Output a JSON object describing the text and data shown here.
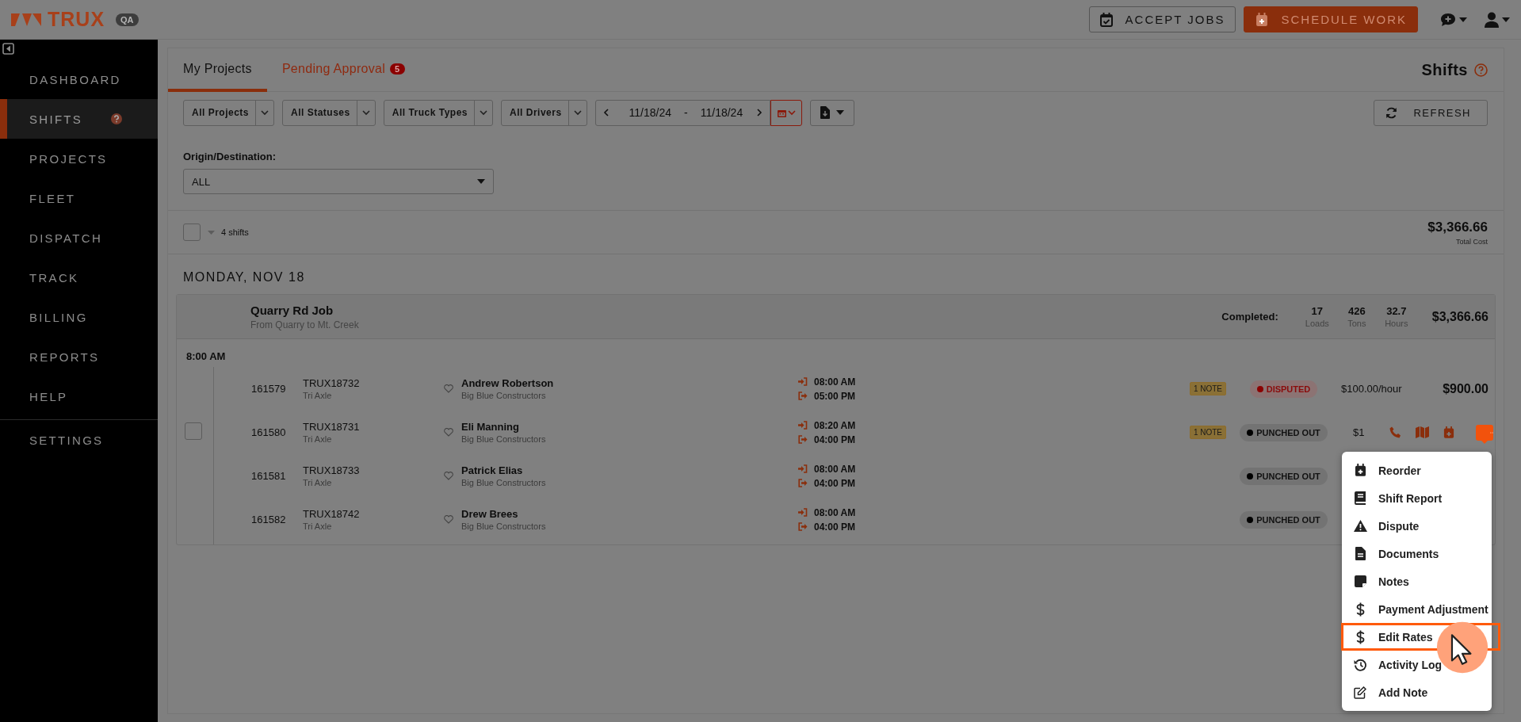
{
  "header": {
    "logo": "TRUX",
    "env_badge": "QA",
    "buttons": [
      {
        "label": "ACCEPT JOBS",
        "kind": "outline"
      },
      {
        "label": "SCHEDULE WORK",
        "kind": "primary"
      }
    ]
  },
  "sidebar": {
    "items": [
      {
        "label": "DASHBOARD",
        "selected": false,
        "help": false
      },
      {
        "label": "SHIFTS",
        "selected": true,
        "help": true
      },
      {
        "label": "PROJECTS",
        "selected": false,
        "help": false
      },
      {
        "label": "FLEET",
        "selected": false,
        "help": false
      },
      {
        "label": "DISPATCH",
        "selected": false,
        "help": false
      },
      {
        "label": "TRACK",
        "selected": false,
        "help": false
      },
      {
        "label": "BILLING",
        "selected": false,
        "help": false
      },
      {
        "label": "REPORTS",
        "selected": false,
        "help": false
      },
      {
        "label": "HELP",
        "selected": false,
        "help": false
      }
    ],
    "footer_items": [
      {
        "label": "SETTINGS",
        "selected": false,
        "help": false
      }
    ]
  },
  "tabs": [
    {
      "label": "My Projects",
      "selected": true
    },
    {
      "label": "Pending Approval",
      "selected": false,
      "badge": "5"
    }
  ],
  "page_title": "Shifts",
  "filters": [
    {
      "label": "All Projects"
    },
    {
      "label": "All Statuses"
    },
    {
      "label": "All Truck Types"
    },
    {
      "label": "All Drivers"
    }
  ],
  "date_range": {
    "start": "11/18/24",
    "separator": "-",
    "end": "11/18/24"
  },
  "refresh": "REFRESH",
  "origin": {
    "label": "Origin/Destination:",
    "value": "ALL"
  },
  "summary": {
    "checked": false,
    "count": "4 shifts",
    "total": "$3,366.66",
    "total_label": "Total Cost"
  },
  "day": "MONDAY, NOV 18",
  "job": {
    "name": "Quarry Rd Job",
    "route": "From Quarry to Mt. Creek",
    "completed_label": "Completed:",
    "stats": [
      {
        "value": "17",
        "label": "Loads"
      },
      {
        "value": "426",
        "label": "Tons"
      },
      {
        "value": "32.7",
        "label": "Hours"
      }
    ],
    "total": "$3,366.66"
  },
  "time_label": "8:00 AM",
  "shifts": [
    {
      "id": "161579",
      "truck": "TRUX18732",
      "truck_type": "Tri Axle",
      "driver": "Andrew Robertson",
      "company": "Big Blue Constructors",
      "in": "08:00 AM",
      "out": "05:00 PM",
      "note": "1 NOTE",
      "status": {
        "kind": "disputed",
        "label": "DISPUTED"
      },
      "rate": "$100.00/hour",
      "amount": "$900.00",
      "hovered": false,
      "checked": false
    },
    {
      "id": "161580",
      "truck": "TRUX18731",
      "truck_type": "Tri Axle",
      "driver": "Eli Manning",
      "company": "Big Blue Constructors",
      "in": "08:20 AM",
      "out": "04:00 PM",
      "note": "1 NOTE",
      "status": {
        "kind": "punched_out",
        "label": "PUNCHED OUT"
      },
      "rate": "$1",
      "hovered": true,
      "checked": false
    },
    {
      "id": "161581",
      "truck": "TRUX18733",
      "truck_type": "Tri Axle",
      "driver": "Patrick Elias",
      "company": "Big Blue Constructors",
      "in": "08:00 AM",
      "out": "04:00 PM",
      "status": {
        "kind": "punched_out",
        "label": "PUNCHED OUT"
      },
      "hovered": false,
      "checked": false
    },
    {
      "id": "161582",
      "truck": "TRUX18742",
      "truck_type": "Tri Axle",
      "driver": "Drew Brees",
      "company": "Big Blue Constructors",
      "in": "08:00 AM",
      "out": "04:00 PM",
      "status": {
        "kind": "punched_out",
        "label": "PUNCHED OUT"
      },
      "hovered": false,
      "checked": false
    }
  ],
  "menu": {
    "items": [
      {
        "label": "Reorder",
        "highlighted": false
      },
      {
        "label": "Shift Report",
        "highlighted": false
      },
      {
        "label": "Dispute",
        "highlighted": false
      },
      {
        "label": "Documents",
        "highlighted": false
      },
      {
        "label": "Notes",
        "highlighted": false
      },
      {
        "label": "Payment Adjustment",
        "highlighted": false
      },
      {
        "label": "Edit Rates",
        "highlighted": true
      },
      {
        "label": "Activity Log",
        "highlighted": false
      },
      {
        "label": "Add Note",
        "highlighted": false
      }
    ]
  }
}
